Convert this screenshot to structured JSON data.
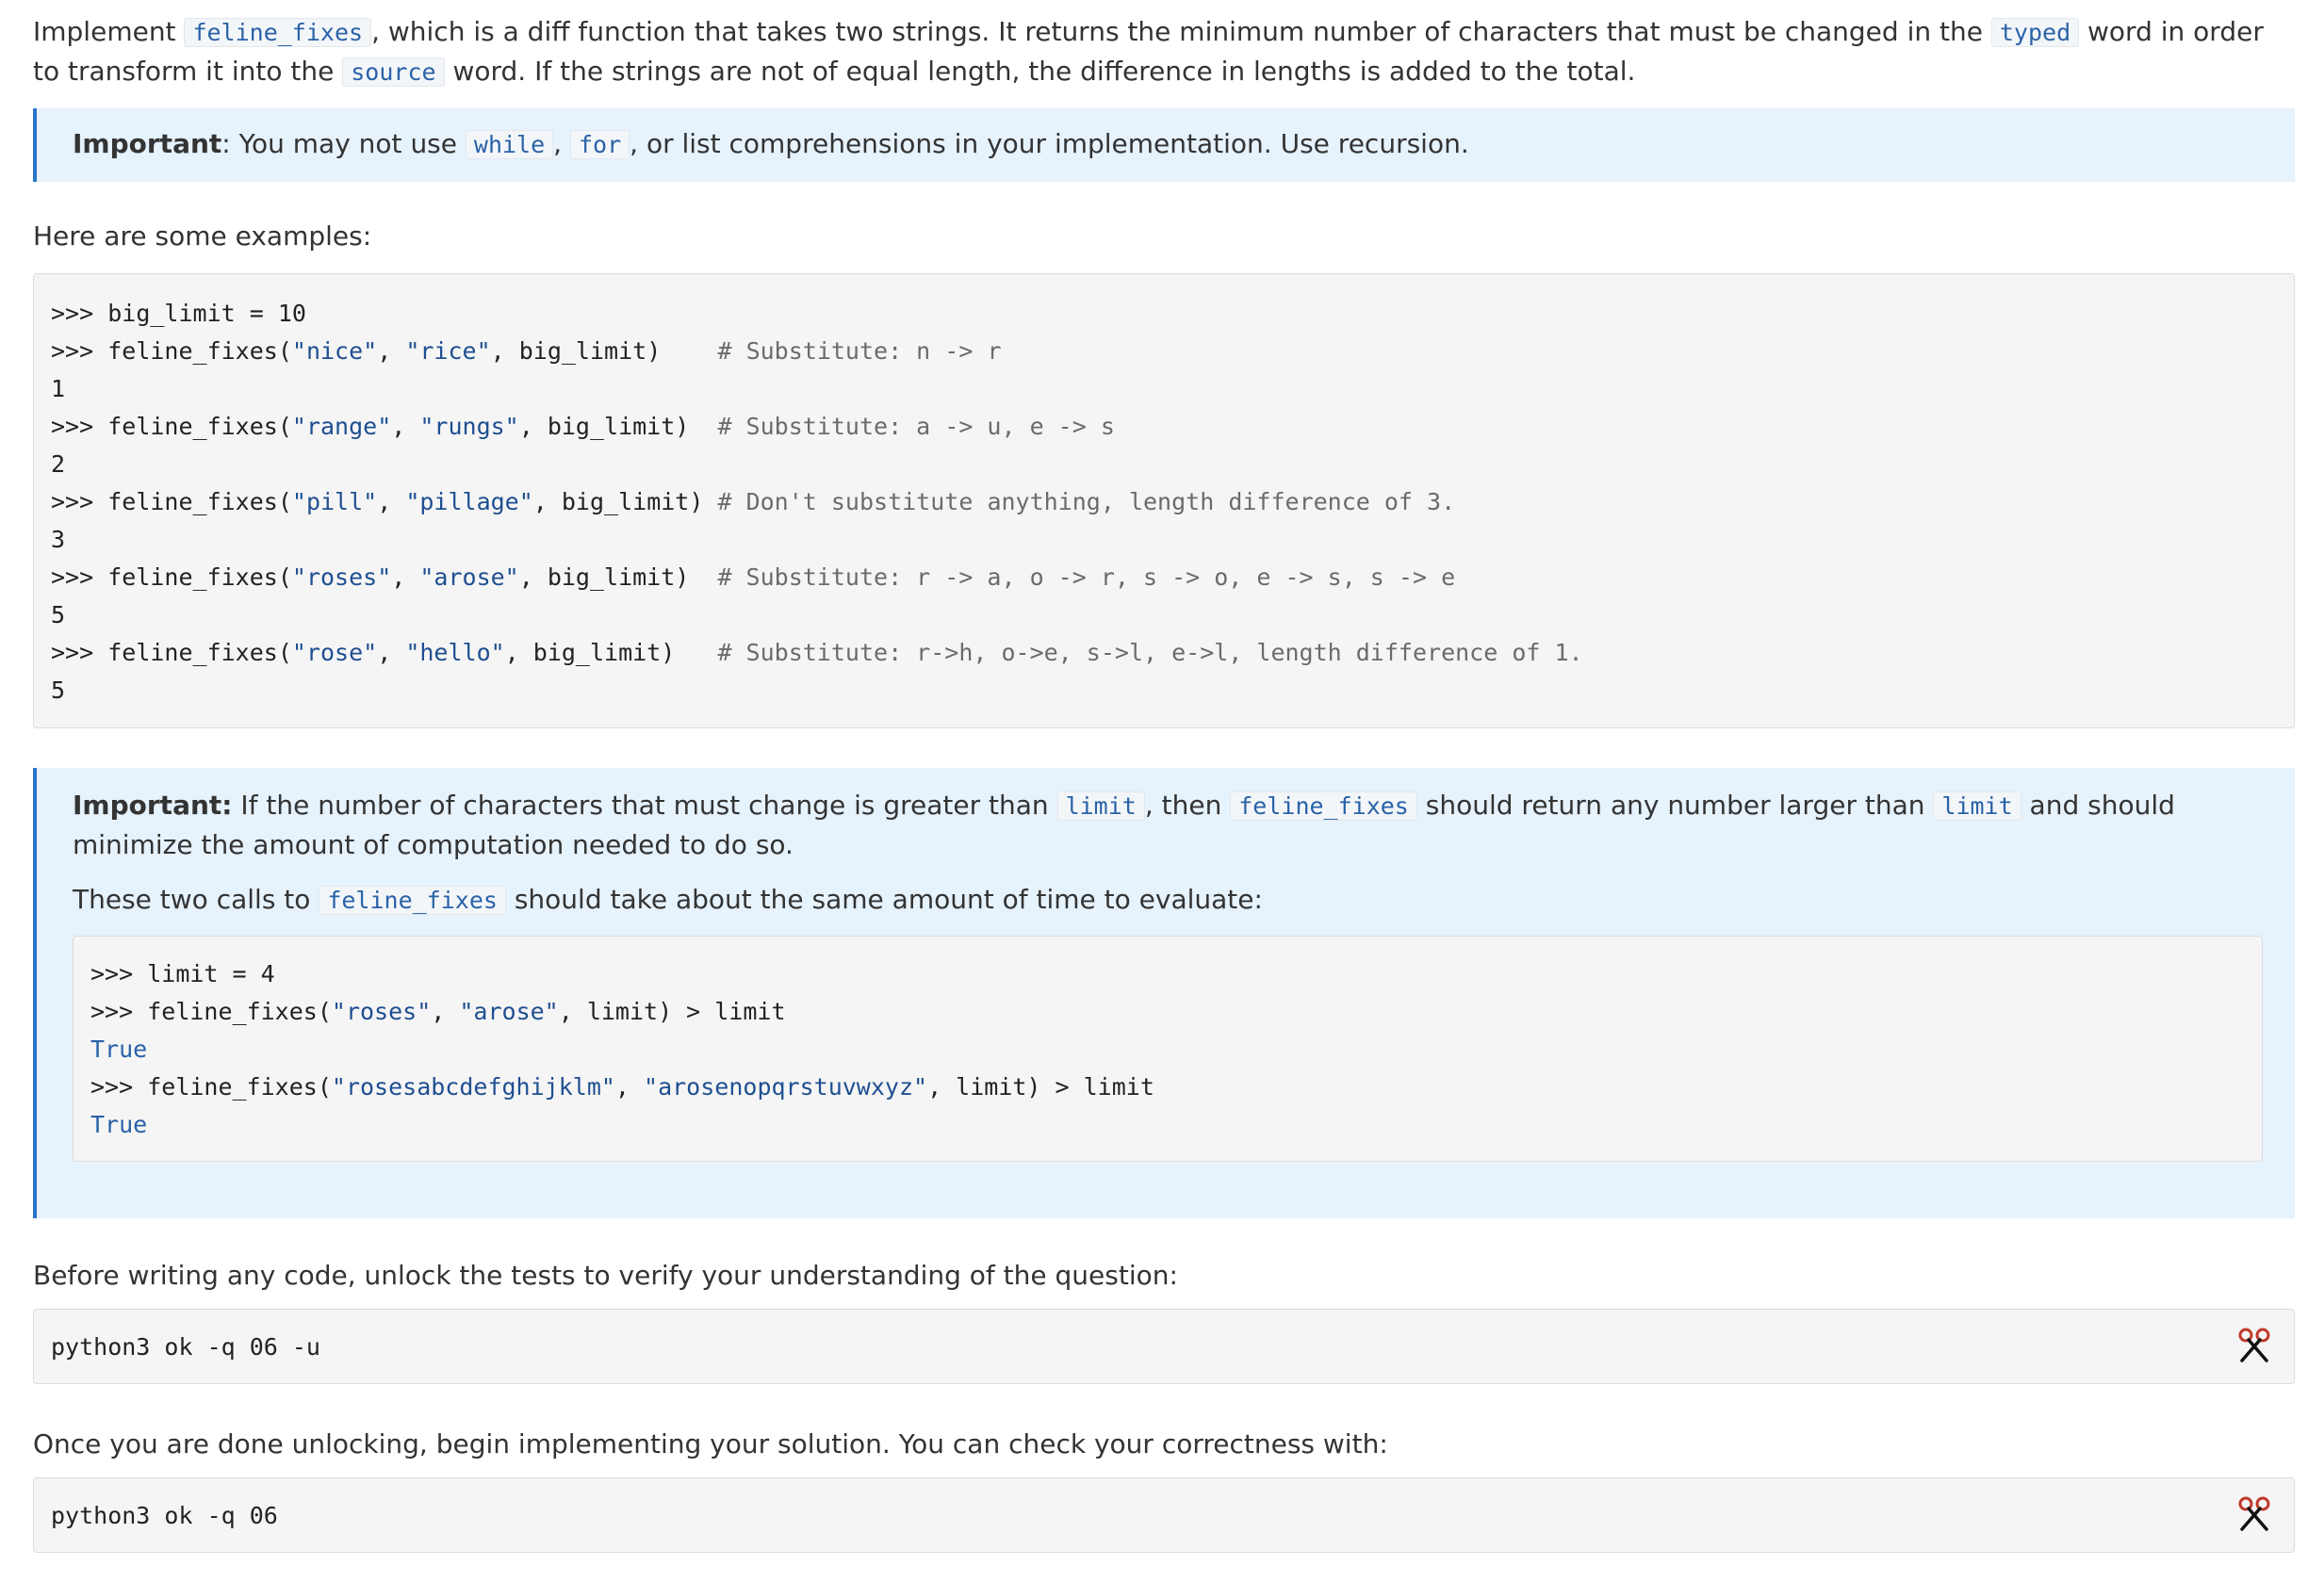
{
  "intro": {
    "t1": "Implement ",
    "c1": "feline_fixes",
    "t2": ", which is a diff function that takes two strings. It returns the minimum number of characters that must be changed in the ",
    "c2": "typed",
    "t3": " word in order to transform it into the ",
    "c3": "source",
    "t4": " word. If the strings are not of equal length, the difference in lengths is added to the total."
  },
  "important1": {
    "label": "Important",
    "t1": ": You may not use ",
    "c1": "while",
    "t2": ", ",
    "c2": "for",
    "t3": ", or list comprehensions in your implementation. Use recursion."
  },
  "examples_heading": "Here are some examples:",
  "examples": [
    {
      "prompt": ">>> ",
      "code": "big_limit = 10"
    },
    {
      "prompt": ">>> ",
      "pre": "feline_fixes(",
      "a": "\"nice\"",
      "sep": ", ",
      "b": "\"rice\"",
      "post": ", big_limit)",
      "pad": "    ",
      "comment": "# Substitute: n -> r"
    },
    {
      "output": "1"
    },
    {
      "prompt": ">>> ",
      "pre": "feline_fixes(",
      "a": "\"range\"",
      "sep": ", ",
      "b": "\"rungs\"",
      "post": ", big_limit)",
      "pad": "  ",
      "comment": "# Substitute: a -> u, e -> s"
    },
    {
      "output": "2"
    },
    {
      "prompt": ">>> ",
      "pre": "feline_fixes(",
      "a": "\"pill\"",
      "sep": ", ",
      "b": "\"pillage\"",
      "post": ", big_limit)",
      "pad": " ",
      "comment": "# Don't substitute anything, length difference of 3."
    },
    {
      "output": "3"
    },
    {
      "prompt": ">>> ",
      "pre": "feline_fixes(",
      "a": "\"roses\"",
      "sep": ", ",
      "b": "\"arose\"",
      "post": ", big_limit)",
      "pad": "  ",
      "comment": "# Substitute: r -> a, o -> r, s -> o, e -> s, s -> e"
    },
    {
      "output": "5"
    },
    {
      "prompt": ">>> ",
      "pre": "feline_fixes(",
      "a": "\"rose\"",
      "sep": ", ",
      "b": "\"hello\"",
      "post": ", big_limit)",
      "pad": "   ",
      "comment": "# Substitute: r->h, o->e, s->l, e->l, length difference of 1."
    },
    {
      "output": "5"
    }
  ],
  "important2": {
    "label": "Important:",
    "t1": " If the number of characters that must change is greater than ",
    "c1": "limit",
    "t2": ", then ",
    "c2": "feline_fixes",
    "t3": " should return any number larger than ",
    "c3": "limit",
    "t4": " and should minimize the amount of computation needed to do so.",
    "p2_t1": "These two calls to ",
    "p2_c1": "feline_fixes",
    "p2_t2": " should take about the same amount of time to evaluate:"
  },
  "limit_examples": [
    {
      "prompt": ">>> ",
      "code": "limit = 4"
    },
    {
      "prompt": ">>> ",
      "pre": "feline_fixes(",
      "a": "\"roses\"",
      "sep": ", ",
      "b": "\"arose\"",
      "post": ", limit) > limit"
    },
    {
      "output": "True"
    },
    {
      "prompt": ">>> ",
      "pre": "feline_fixes(",
      "a": "\"rosesabcdefghijklm\"",
      "sep": ", ",
      "b": "\"arosenopqrstuvwxyz\"",
      "post": ", limit) > limit"
    },
    {
      "output": "True"
    }
  ],
  "unlock_text": "Before writing any code, unlock the tests to verify your understanding of the question:",
  "unlock_cmd": "python3 ok -q 06 -u",
  "check_text": "Once you are done unlocking, begin implementing your solution. You can check your correctness with:",
  "check_cmd": "python3 ok -q 06",
  "icons": {
    "copy": "scissors-icon"
  },
  "colors": {
    "code_blue": "#2a62a8",
    "callout_bg": "#e6f2fc",
    "callout_border": "#2b74c9"
  }
}
